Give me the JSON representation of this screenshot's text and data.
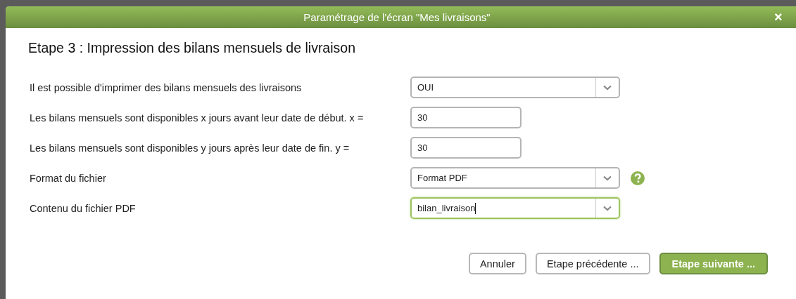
{
  "dialog": {
    "title": "Paramétrage de l'écran \"Mes livraisons\"",
    "close": "×",
    "heading": "Etape 3 : Impression des bilans mensuels de livraison",
    "fields": [
      {
        "kind": "select",
        "label": "Il est possible d'imprimer des bilans mensuels des livraisons",
        "value": "OUI",
        "focused": false,
        "help": false
      },
      {
        "kind": "input",
        "label": "Les bilans mensuels sont disponibles x jours avant leur date de début. x =",
        "value": "30",
        "focused": false,
        "help": false
      },
      {
        "kind": "input",
        "label": "Les bilans mensuels sont disponibles y jours après leur date de fin. y =",
        "value": "30",
        "focused": false,
        "help": false
      },
      {
        "kind": "select",
        "label": "Format du fichier",
        "value": "Format PDF",
        "focused": false,
        "help": true
      },
      {
        "kind": "select",
        "label": "Contenu du fichier PDF",
        "value": "bilan_livraison",
        "focused": true,
        "help": false
      }
    ],
    "buttons": [
      {
        "label": "Annuler",
        "kind": "default"
      },
      {
        "label": "Etape précédente ...",
        "kind": "default"
      },
      {
        "label": "Etape suivante ...",
        "kind": "primary"
      }
    ]
  }
}
